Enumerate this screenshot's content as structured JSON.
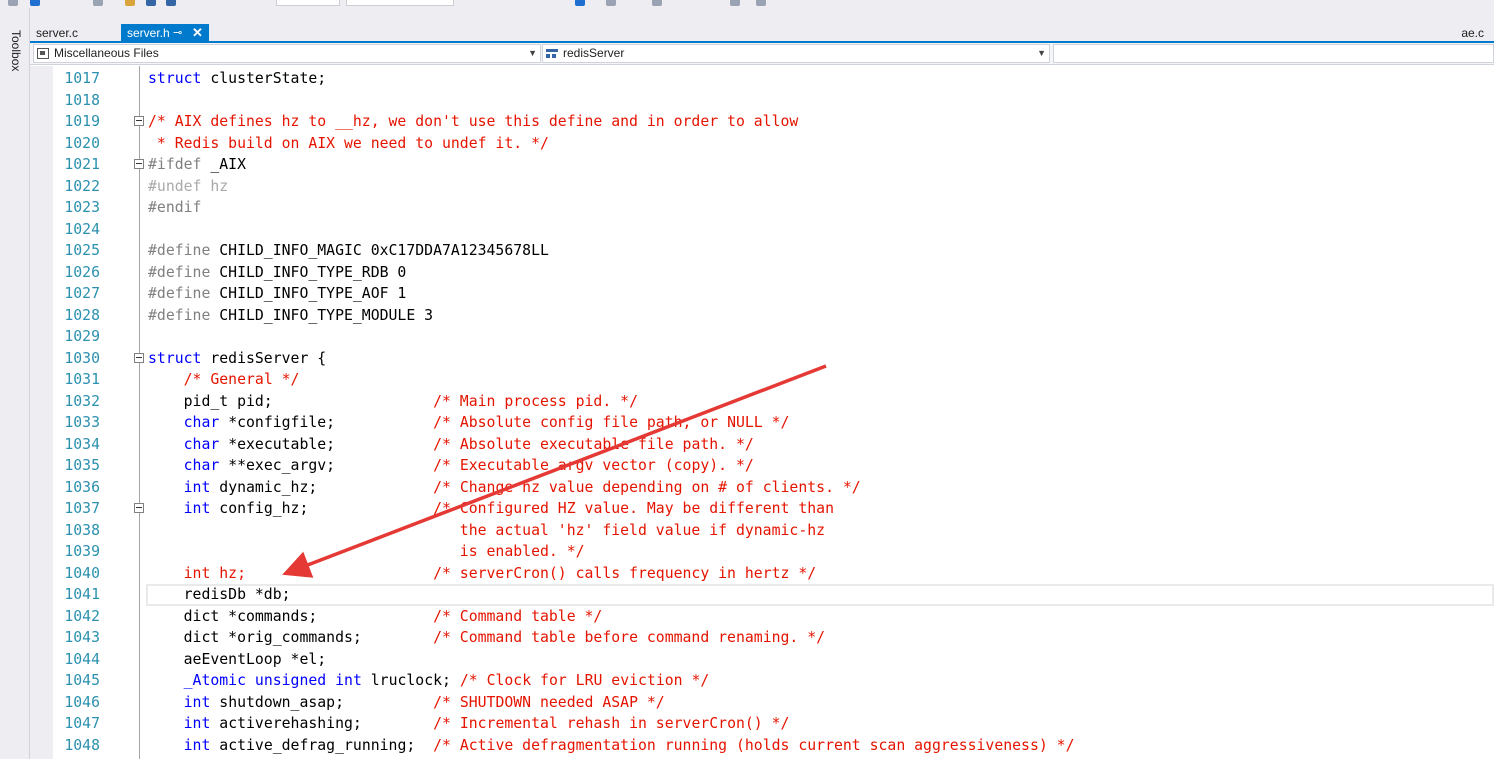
{
  "sidebar": {
    "toolbox_label": "Toolbox"
  },
  "tabs": {
    "items": [
      {
        "label": "server.c",
        "active": false
      },
      {
        "label": "server.h",
        "active": true
      }
    ],
    "right_tab": "ae.c",
    "pin_glyph": "⊸",
    "close_glyph": "✕"
  },
  "navigation": {
    "project": "Miscellaneous Files",
    "scope": "redisServer",
    "member": ""
  },
  "editor": {
    "current_line": 1041,
    "lines": [
      {
        "n": "1017",
        "code": "struct clusterState;"
      },
      {
        "n": "1018",
        "code": ""
      },
      {
        "n": "1019",
        "code": "/* AIX defines hz to __hz, we don't use this define and in order to allow"
      },
      {
        "n": "1020",
        "code": " * Redis build on AIX we need to undef it. */"
      },
      {
        "n": "1021",
        "code": "#ifdef _AIX"
      },
      {
        "n": "1022",
        "code": "#undef hz"
      },
      {
        "n": "1023",
        "code": "#endif"
      },
      {
        "n": "1024",
        "code": ""
      },
      {
        "n": "1025",
        "code": "#define CHILD_INFO_MAGIC 0xC17DDA7A12345678LL"
      },
      {
        "n": "1026",
        "code": "#define CHILD_INFO_TYPE_RDB 0"
      },
      {
        "n": "1027",
        "code": "#define CHILD_INFO_TYPE_AOF 1"
      },
      {
        "n": "1028",
        "code": "#define CHILD_INFO_TYPE_MODULE 3"
      },
      {
        "n": "1029",
        "code": ""
      },
      {
        "n": "1030",
        "code": "struct redisServer {"
      },
      {
        "n": "1031",
        "code": "    /* General */"
      },
      {
        "n": "1032",
        "code": "    pid_t pid;                  /* Main process pid. */"
      },
      {
        "n": "1033",
        "code": "    char *configfile;           /* Absolute config file path, or NULL */"
      },
      {
        "n": "1034",
        "code": "    char *executable;           /* Absolute executable file path. */"
      },
      {
        "n": "1035",
        "code": "    char **exec_argv;           /* Executable argv vector (copy). */"
      },
      {
        "n": "1036",
        "code": "    int dynamic_hz;             /* Change hz value depending on # of clients. */"
      },
      {
        "n": "1037",
        "code": "    int config_hz;              /* Configured HZ value. May be different than"
      },
      {
        "n": "1038",
        "code": "                                   the actual 'hz' field value if dynamic-hz"
      },
      {
        "n": "1039",
        "code": "                                   is enabled. */"
      },
      {
        "n": "1040",
        "code": "    int hz;                     /* serverCron() calls frequency in hertz */"
      },
      {
        "n": "1041",
        "code": "    redisDb *db;"
      },
      {
        "n": "1042",
        "code": "    dict *commands;             /* Command table */"
      },
      {
        "n": "1043",
        "code": "    dict *orig_commands;        /* Command table before command renaming. */"
      },
      {
        "n": "1044",
        "code": "    aeEventLoop *el;"
      },
      {
        "n": "1045",
        "code": "    _Atomic unsigned int lruclock; /* Clock for LRU eviction */"
      },
      {
        "n": "1046",
        "code": "    int shutdown_asap;          /* SHUTDOWN needed ASAP */"
      },
      {
        "n": "1047",
        "code": "    int activerehashing;        /* Incremental rehash in serverCron() */"
      },
      {
        "n": "1048",
        "code": "    int active_defrag_running;  /* Active defragmentation running (holds current scan aggressiveness) */"
      }
    ]
  },
  "annotation": {
    "color": "#e53935"
  }
}
